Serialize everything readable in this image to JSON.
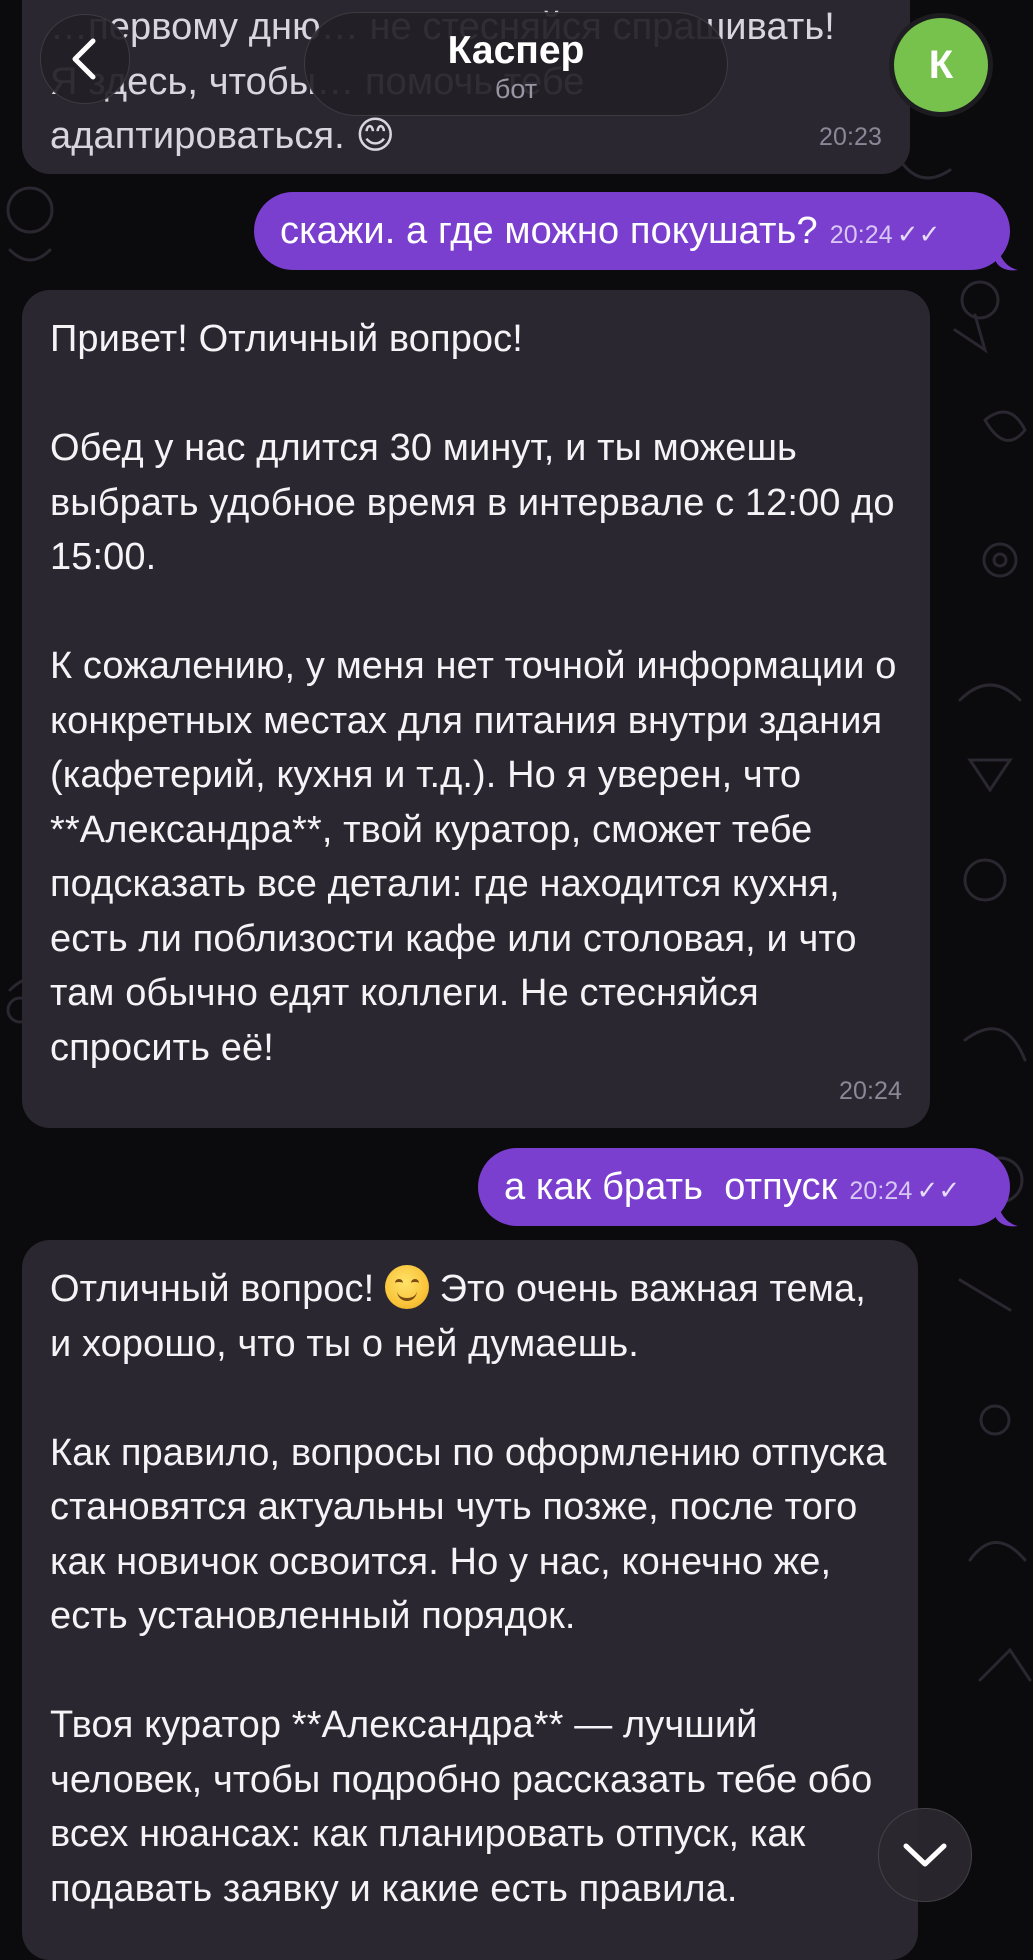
{
  "header": {
    "title": "Каспер",
    "subtitle": "бот",
    "avatar_letter": "К",
    "avatar_color": "#77c24d"
  },
  "icons": {
    "back": "chevron-left-icon",
    "scroll_down": "chevron-down-icon",
    "read_status": "double-check-icon",
    "emoji": "smiling-face-emoji"
  },
  "colors": {
    "outgoing_bubble": "#7a3fce",
    "incoming_bubble": "#2b2730",
    "background": "#0b0a0d"
  },
  "messages": [
    {
      "direction": "incoming",
      "lines": [
        "…первому дню… не стесняйся спрашивать!",
        "Я здесь, чтобы… помочь тебе адаптироваться. 😊"
      ],
      "time": "20:23"
    },
    {
      "direction": "outgoing",
      "text": "скажи. а где можно покушать?",
      "time": "20:24",
      "status": "read"
    },
    {
      "direction": "incoming",
      "p1": "Привет! Отличный вопрос!",
      "p2": "Обед у нас длится 30 минут, и ты можешь выбрать удобное время в интервале с 12:00 до 15:00.",
      "p3": "К сожалению, у меня нет точной информации о конкретных местах для питания внутри здания (кафетерий, кухня и т.д.). Но я уверен, что **Александра**, твой куратор, сможет тебе подсказать все детали: где находится кухня, есть ли поблизости кафе или столовая, и что там обычно едят коллеги. Не стесняйся спросить её!",
      "time": "20:24"
    },
    {
      "direction": "outgoing",
      "text": "а как брать  отпуск",
      "time": "20:24",
      "status": "read"
    },
    {
      "direction": "incoming",
      "p1_before_emoji": "Отличный вопрос!",
      "p1_after_emoji": "Это очень важная тема, и хорошо, что ты о ней думаешь.",
      "p2": "Как правило, вопросы по оформлению отпуска становятся актуальны чуть позже, после того как новичок освоится. Но у нас, конечно же, есть установленный порядок.",
      "p3": "Твоя куратор **Александра** — лучший человек, чтобы подробно рассказать тебе обо всех нюансах: как планировать отпуск, как подавать заявку и какие есть правила."
    }
  ]
}
